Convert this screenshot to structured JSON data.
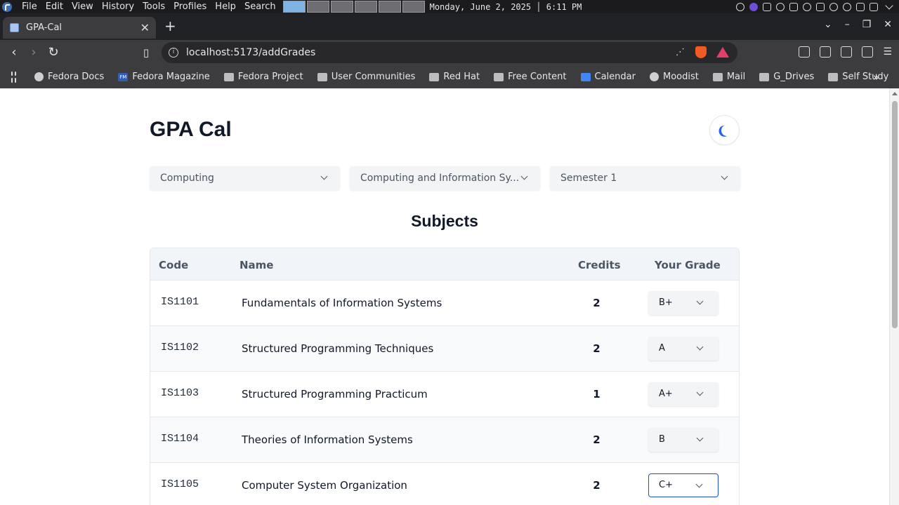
{
  "system": {
    "menu": [
      "File",
      "Edit",
      "View",
      "History",
      "Tools",
      "Profiles",
      "Help",
      "Search"
    ],
    "clock": "Monday, June 2, 2025 │ 6:11 PM"
  },
  "browser": {
    "tab_title": "GPA-Cal",
    "url": "localhost:5173/addGrades",
    "bookmarks": [
      {
        "label": "Fedora Docs",
        "icon": "globe-icon"
      },
      {
        "label": "Fedora Magazine",
        "icon": "fm-icon"
      },
      {
        "label": "Fedora Project",
        "icon": "folder-icon"
      },
      {
        "label": "User Communities",
        "icon": "folder-icon"
      },
      {
        "label": "Red Hat",
        "icon": "folder-icon"
      },
      {
        "label": "Free Content",
        "icon": "folder-icon"
      },
      {
        "label": "Calendar",
        "icon": "calendar-icon"
      },
      {
        "label": "Moodist",
        "icon": "globe-icon"
      },
      {
        "label": "Mail",
        "icon": "folder-icon"
      },
      {
        "label": "G_Drives",
        "icon": "folder-icon"
      },
      {
        "label": "Self Study",
        "icon": "folder-icon"
      }
    ]
  },
  "app": {
    "title": "GPA Cal",
    "filters": {
      "faculty": "Computing",
      "degree": "Computing and Information Sy...",
      "semester": "Semester 1"
    },
    "section_title": "Subjects",
    "table_headers": {
      "code": "Code",
      "name": "Name",
      "credits": "Credits",
      "grade": "Your Grade"
    },
    "subjects": [
      {
        "code": "IS1101",
        "name": "Fundamentals of Information Systems",
        "credits": "2",
        "grade": "B+"
      },
      {
        "code": "IS1102",
        "name": "Structured Programming Techniques",
        "credits": "2",
        "grade": "A"
      },
      {
        "code": "IS1103",
        "name": "Structured Programming Practicum",
        "credits": "1",
        "grade": "A+"
      },
      {
        "code": "IS1104",
        "name": "Theories of Information Systems",
        "credits": "2",
        "grade": "B"
      },
      {
        "code": "IS1105",
        "name": "Computer System Organization",
        "credits": "2",
        "grade": "C+"
      }
    ]
  },
  "colors": {
    "accent": "#1d4ed8",
    "header_bg": "#f1f5f9"
  }
}
